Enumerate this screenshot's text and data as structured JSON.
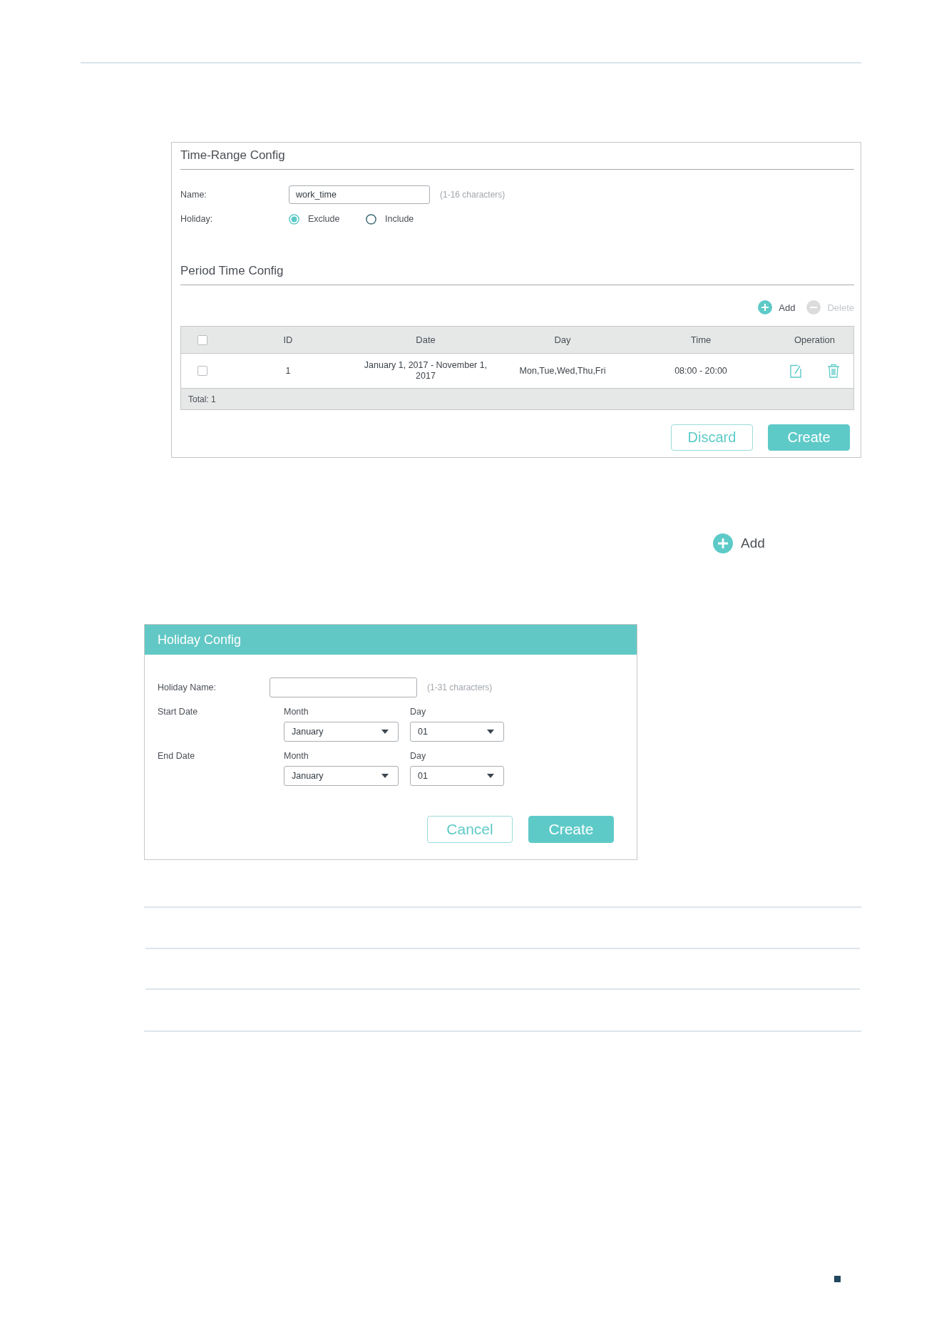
{
  "config_panel": {
    "time_range": {
      "title": "Time-Range Config",
      "name": {
        "label": "Name:",
        "value": "work_time",
        "note": "(1-16 characters)"
      },
      "holiday": {
        "label": "Holiday:",
        "options": [
          {
            "label": "Exclude",
            "selected": true
          },
          {
            "label": "Include",
            "selected": false
          }
        ]
      }
    },
    "period": {
      "title": "Period Time Config",
      "toolbar": [
        {
          "kind": "add",
          "label": "Add",
          "disabled": false
        },
        {
          "kind": "delete",
          "label": "Delete",
          "disabled": true
        }
      ],
      "table": {
        "select_all_checked": false,
        "columns": [
          "ID",
          "Date",
          "Day",
          "Time",
          "Operation"
        ],
        "rows": [
          {
            "checked": false,
            "cells": [
              "1",
              "January 1, 2017 - November 1, 2017",
              "Mon,Tue,Wed,Thu,Fri",
              "08:00 - 20:00"
            ]
          }
        ],
        "footer": "Total: 1"
      }
    },
    "buttons": [
      {
        "kind": "secondary",
        "label": "Discard"
      },
      {
        "kind": "primary",
        "label": "Create"
      }
    ]
  },
  "add_legend": {
    "label": "Add"
  },
  "holiday_dialog": {
    "title": "Holiday Config",
    "name": {
      "label": "Holiday Name:",
      "note": "(1-31 characters)"
    },
    "dates": [
      {
        "label": "Start Date",
        "fields": [
          {
            "label": "Month",
            "value": "January"
          },
          {
            "label": "Day",
            "value": "01"
          }
        ]
      },
      {
        "label": "End Date",
        "fields": [
          {
            "label": "Month",
            "value": "January"
          },
          {
            "label": "Day",
            "value": "01"
          }
        ]
      }
    ],
    "buttons": [
      {
        "kind": "secondary",
        "label": "Cancel"
      },
      {
        "kind": "primary",
        "label": "Create"
      }
    ]
  }
}
